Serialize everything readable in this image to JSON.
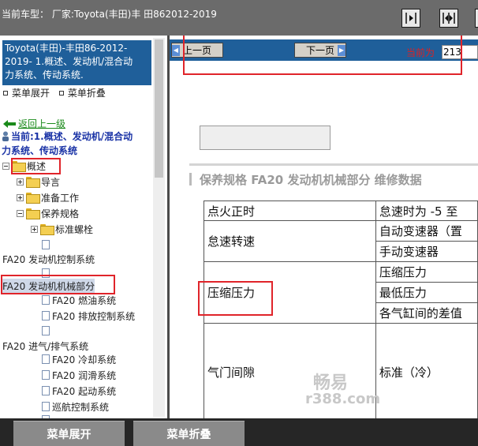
{
  "topbar": {
    "car_label": "当前车型： 厂家:Toyota(丰田)丰 田862012-2019"
  },
  "left_panel": {
    "title_lines": [
      "Toyota(丰田)-丰田86-2012-",
      "2019- 1.概述、发动机/混合动",
      "力系统、传动系统."
    ],
    "expand_label": "菜单展开",
    "collapse_label": "菜单折叠",
    "back_label": "返回上一级",
    "current_node_line1": "当前:1.概述、发动机/混合动",
    "current_node_line2": "力系统、传动系统",
    "tree": [
      {
        "label": "概述"
      },
      {
        "label": "导言"
      },
      {
        "label": "准备工作"
      },
      {
        "label": "保养规格"
      },
      {
        "label": "标准螺栓"
      },
      {
        "label": "FA20 发动机控制系统"
      },
      {
        "label": "FA20 发动机机械部分"
      },
      {
        "label": "FA20 燃油系统"
      },
      {
        "label": "FA20 排放控制系统"
      },
      {
        "label": "FA20 进气/排气系统"
      },
      {
        "label": "FA20 冷却系统"
      },
      {
        "label": "FA20 润滑系统"
      },
      {
        "label": "FA20 起动系统"
      },
      {
        "label": "巡航控制系统"
      }
    ]
  },
  "right_panel": {
    "prev_label": "上一页",
    "next_label": "下一页",
    "current_page_label": "当前为",
    "current_page_value": "213",
    "doc_heading": "保养规格  FA20 发动机机械部分  维修数据",
    "table": {
      "r1c1": "点火正时",
      "r1c2": "怠速时为 -5 至",
      "r2c1": "怠速转速",
      "r2c2": "自动变速器（置",
      "r3c2": "手动变速器",
      "r4c1": "压缩压力",
      "r4c2": "压缩压力",
      "r5c2": "最低压力",
      "r6c2": "各气缸间的差值",
      "r7c1": "气门间隙",
      "r7c2": "标准（冷）"
    },
    "watermark_1": "畅易",
    "watermark_2": "r388.com"
  },
  "bottombar": {
    "expand_label": "菜单展开",
    "collapse_label": "菜单折叠"
  },
  "colors": {
    "title_blue": "#1f5f9a",
    "highlight_red": "#e0242a",
    "current_node_blue": "#1a33a6",
    "back_link_green": "#1a8a1a"
  }
}
